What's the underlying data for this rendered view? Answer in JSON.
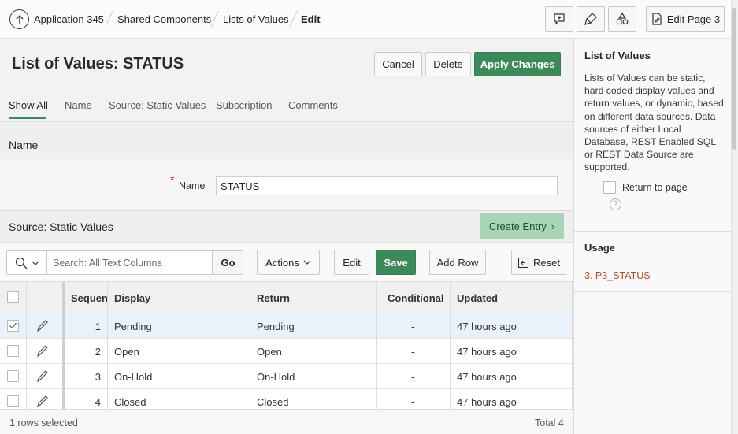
{
  "breadcrumb": {
    "items": [
      "Application 345",
      "Shared Components",
      "Lists of Values",
      "Edit"
    ]
  },
  "toolbar": {
    "edit_page_label": "Edit Page 3"
  },
  "page": {
    "title": "List of Values: STATUS",
    "cancel_label": "Cancel",
    "delete_label": "Delete",
    "apply_label": "Apply Changes"
  },
  "tabs": [
    "Show All",
    "Name",
    "Source: Static Values",
    "Subscription",
    "Comments"
  ],
  "name_section": {
    "title": "Name",
    "field_label": "Name",
    "required_mark": "*",
    "field_value": "STATUS"
  },
  "source_section": {
    "title": "Source: Static Values",
    "create_entry_label": "Create Entry"
  },
  "grid_toolbar": {
    "search_placeholder": "Search: All Text Columns",
    "go_label": "Go",
    "actions_label": "Actions",
    "edit_label": "Edit",
    "save_label": "Save",
    "add_row_label": "Add Row",
    "reset_label": "Reset"
  },
  "grid": {
    "columns": [
      "Sequence",
      "Display",
      "Return",
      "Conditional",
      "Updated"
    ],
    "rows": [
      {
        "seq": "1",
        "display": "Pending",
        "return": "Pending",
        "conditional": "-",
        "updated": "47 hours ago",
        "selected": true
      },
      {
        "seq": "2",
        "display": "Open",
        "return": "Open",
        "conditional": "-",
        "updated": "47 hours ago",
        "selected": false
      },
      {
        "seq": "3",
        "display": "On-Hold",
        "return": "On-Hold",
        "conditional": "-",
        "updated": "47 hours ago",
        "selected": false
      },
      {
        "seq": "4",
        "display": "Closed",
        "return": "Closed",
        "conditional": "-",
        "updated": "47 hours ago",
        "selected": false
      }
    ],
    "footer_selected": "1 rows selected",
    "footer_total": "Total 4"
  },
  "side_panel": {
    "title": "List of Values",
    "description": "Lists of Values can be static, hard coded display values and return values, or dynamic, based on different data sources. Data sources of either Local Database, REST Enabled SQL or REST Data Source are supported.",
    "return_to_page_label": "Return to page",
    "usage_title": "Usage",
    "usage_link": "3. P3_STATUS"
  },
  "colors": {
    "accent": "#3c8a5a",
    "create_entry_bg": "#a8d5b8",
    "usage_link": "#b44a1f"
  },
  "icons": [
    "up-circle-arrow-icon",
    "add-comment-icon",
    "brush-icon",
    "shapes-icon",
    "edit-page-icon",
    "search-icon",
    "chevron-down-icon",
    "reset-icon",
    "pencil-icon",
    "help-icon",
    "chevron-right-icon"
  ]
}
